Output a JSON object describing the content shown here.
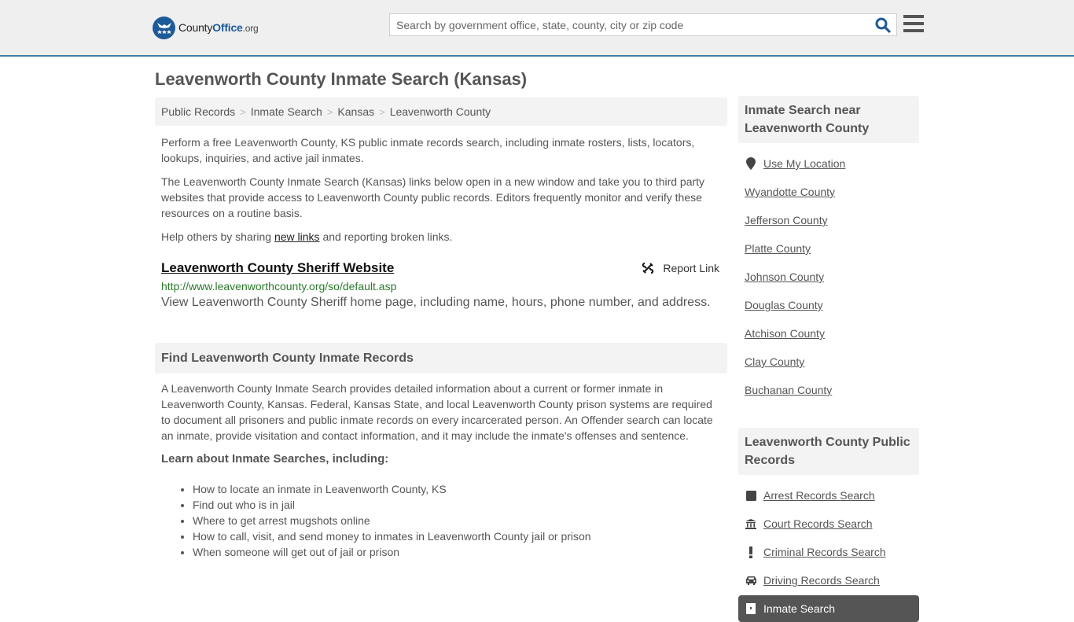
{
  "header": {
    "logo": {
      "county": "County",
      "office": "Office",
      "org": ".org"
    },
    "search_placeholder": "Search by government office, state, county, city or zip code",
    "search_icon": "search-icon",
    "menu_icon": "hamburger-menu-icon"
  },
  "page_title": "Leavenworth County Inmate Search (Kansas)",
  "breadcrumb": [
    {
      "label": "Public Records"
    },
    {
      "label": "Inmate Search"
    },
    {
      "label": "Kansas"
    },
    {
      "label": "Leavenworth County"
    }
  ],
  "intro": {
    "p1": "Perform a free Leavenworth County, KS public inmate records search, including inmate rosters, lists, locators, lookups, inquiries, and active jail inmates.",
    "p2": "The Leavenworth County Inmate Search (Kansas) links below open in a new window and take you to third party websites that provide access to Leavenworth County public records. Editors frequently monitor and verify these resources on a routine basis.",
    "p3_before": "Help others by sharing ",
    "p3_link": "new links",
    "p3_after": " and reporting broken links."
  },
  "listing": {
    "title": "Leavenworth County Sheriff Website",
    "url": "http://www.leavenworthcounty.org/so/default.asp",
    "description": "View Leavenworth County Sheriff home page, including name, hours, phone number, and address.",
    "report_label": "Report Link"
  },
  "find_section": {
    "heading": "Find Leavenworth County Inmate Records",
    "body": "A Leavenworth County Inmate Search provides detailed information about a current or former inmate in Leavenworth County, Kansas. Federal, Kansas State, and local Leavenworth County prison systems are required to document all prisoners and public inmate records on every incarcerated person. An Offender search can locate an inmate, provide visitation and contact information, and it may include the inmate's offenses and sentence.",
    "learn_heading": "Learn about Inmate Searches, including:",
    "bullets": [
      "How to locate an inmate in Leavenworth County, KS",
      "Find out who is in jail",
      "Where to get arrest mugshots online",
      "How to call, visit, and send money to inmates in Leavenworth County jail or prison",
      "When someone will get out of jail or prison"
    ]
  },
  "sidebar": {
    "near_heading": "Inmate Search near Leavenworth County",
    "use_location": "Use My Location",
    "counties": [
      "Wyandotte County",
      "Jefferson County",
      "Platte County",
      "Johnson County",
      "Douglas County",
      "Atchison County",
      "Clay County",
      "Buchanan County"
    ],
    "records_heading": "Leavenworth County Public Records",
    "records": [
      {
        "label": "Arrest Records Search",
        "icon": "square-icon"
      },
      {
        "label": "Court Records Search",
        "icon": "courthouse-icon"
      },
      {
        "label": "Criminal Records Search",
        "icon": "exclamation-icon"
      },
      {
        "label": "Driving Records Search",
        "icon": "car-icon"
      },
      {
        "label": "Inmate Search",
        "icon": "jail-door-icon",
        "active": true
      }
    ]
  },
  "colors": {
    "brand_blue": "#1e5a99",
    "header_border": "#3d7eaa",
    "url_green": "#2a7a2a",
    "active_item_bg": "#555555"
  }
}
